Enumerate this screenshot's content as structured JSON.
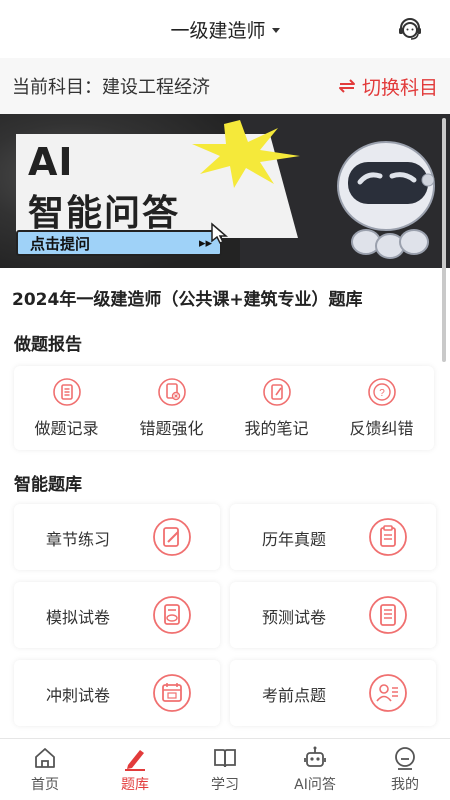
{
  "header": {
    "title": "一级建造师"
  },
  "subject": {
    "current": "当前科目：建设工程经济",
    "switch_label": "切换科目"
  },
  "banner": {
    "line1": "AI",
    "line2": "智能问答",
    "button": "点击提问",
    "button_arrows": "▸▸"
  },
  "bank_title": "2024年一级建造师（公共课+建筑专业）题库",
  "report": {
    "title": "做题报告",
    "items": [
      {
        "label": "做题记录",
        "icon": "list-doc-icon"
      },
      {
        "label": "错题强化",
        "icon": "wrong-doc-icon"
      },
      {
        "label": "我的笔记",
        "icon": "note-icon"
      },
      {
        "label": "反馈纠错",
        "icon": "question-icon"
      }
    ]
  },
  "smart_bank": {
    "title": "智能题库",
    "items": [
      {
        "label": "章节练习",
        "icon": "pencil-icon"
      },
      {
        "label": "历年真题",
        "icon": "clipboard-icon"
      },
      {
        "label": "模拟试卷",
        "icon": "score-paper-icon"
      },
      {
        "label": "预测试卷",
        "icon": "list-paper-icon"
      },
      {
        "label": "冲刺试卷",
        "icon": "calendar-icon"
      },
      {
        "label": "考前点题",
        "icon": "person-list-icon"
      }
    ]
  },
  "tabbar": {
    "items": [
      {
        "label": "首页",
        "icon": "home-icon"
      },
      {
        "label": "题库",
        "icon": "pen-icon",
        "active": true
      },
      {
        "label": "学习",
        "icon": "book-icon"
      },
      {
        "label": "AI问答",
        "icon": "robot-icon"
      },
      {
        "label": "我的",
        "icon": "profile-icon"
      }
    ]
  },
  "colors": {
    "accent": "#e23b3b",
    "icon_red": "#f07070",
    "banner_bg": "#2b2b2e",
    "banner_button": "#9fd2f8"
  }
}
